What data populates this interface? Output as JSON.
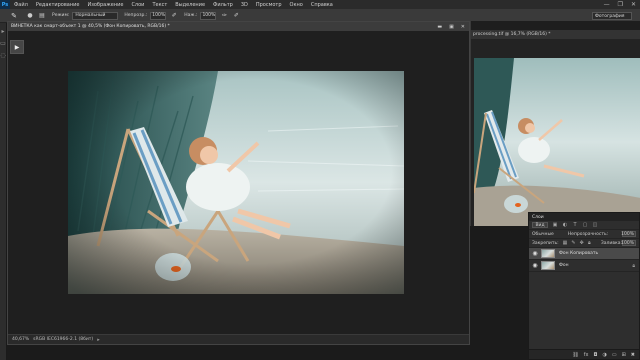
{
  "app": {
    "logo": "Ps"
  },
  "menu": [
    "Файл",
    "Редактирование",
    "Изображение",
    "Слои",
    "Текст",
    "Выделение",
    "Фильтр",
    "3D",
    "Просмотр",
    "Окно",
    "Справка"
  ],
  "window_controls": [
    "—",
    "❐",
    "✕"
  ],
  "options": {
    "tool_icon": "brush-icon",
    "mode_label": "Режим:",
    "mode_value": "Нормальный",
    "opacity_label": "Непрозр.:",
    "opacity_value": "100%",
    "flow_label": "Наж.:",
    "flow_value": "100%",
    "workspace_value": "Фотография"
  },
  "document": {
    "title": "ВИНЕТКА как смарт-объект 1 @ 40,5% (Фон Копировать, RGB/16) *",
    "zoom": "40,67%",
    "status_info": "sRGB IEC61966-2.1 (8бит)",
    "tool_button": "▶"
  },
  "document2": {
    "title": "processing.tif @ 16,7% (RGB/16) *"
  },
  "layers_panel": {
    "tab": "Слои",
    "kind_label": "Вид",
    "blend_mode": "Обычные",
    "opacity_label": "Непрозрачность:",
    "opacity_value": "100%",
    "lock_label": "Закрепить:",
    "fill_label": "Заливка:",
    "fill_value": "100%",
    "layers": [
      {
        "name": "Фон Копировать",
        "selected": true
      },
      {
        "name": "Фон",
        "selected": false
      }
    ],
    "footer_icons": [
      "link-icon",
      "fx-icon",
      "mask-icon",
      "adjustment-icon",
      "folder-icon",
      "new-layer-icon",
      "trash-icon"
    ]
  },
  "colors": {
    "accent": "#31a8ff",
    "bg": "#282828",
    "panel": "#2e2e2e"
  }
}
